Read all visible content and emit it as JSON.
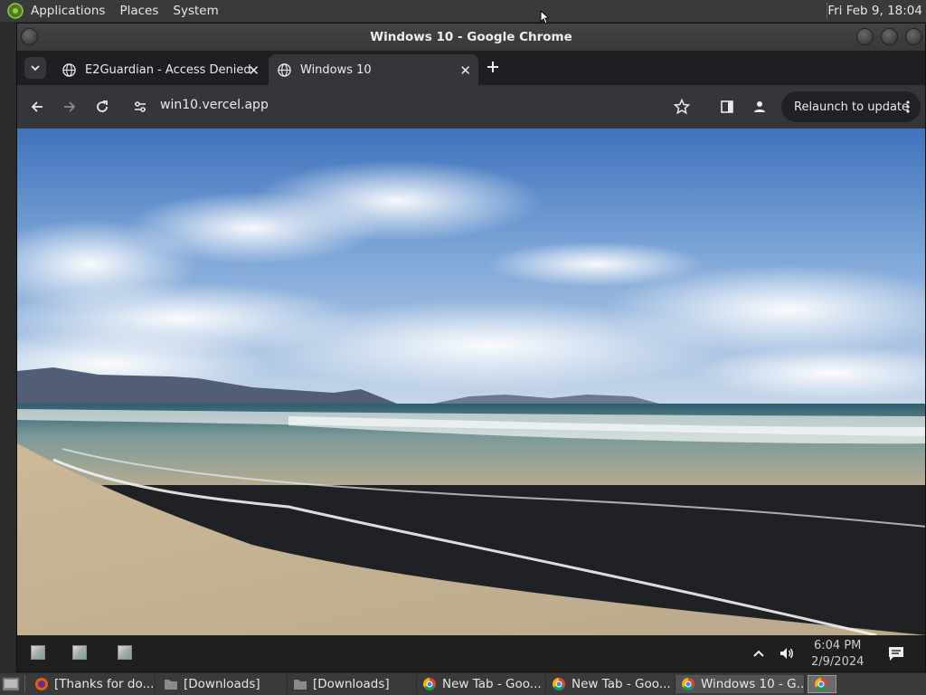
{
  "top_panel": {
    "menus": [
      "Applications",
      "Places",
      "System"
    ],
    "clock": "Fri Feb  9, 18:04"
  },
  "window": {
    "title": "Windows 10 - Google Chrome"
  },
  "tabs": [
    {
      "label": "E2Guardian - Access Denied",
      "active": false
    },
    {
      "label": "Windows 10",
      "active": true
    }
  ],
  "toolbar": {
    "url": "win10.vercel.app",
    "relaunch_label": "Relaunch to update"
  },
  "win_taskbar": {
    "time": "6:04 PM",
    "date": "2/9/2024"
  },
  "bottom_panel": {
    "tasks": [
      {
        "label": "[Thanks for do...",
        "icon": "firefox-icon",
        "active": false
      },
      {
        "label": "[Downloads]",
        "icon": "folder-icon",
        "active": false
      },
      {
        "label": "[Downloads]",
        "icon": "folder-icon",
        "active": false
      },
      {
        "label": "New Tab - Goo...",
        "icon": "chrome-icon",
        "active": false
      },
      {
        "label": "New Tab - Goo...",
        "icon": "chrome-icon",
        "active": false
      },
      {
        "label": "Windows 10 - G...",
        "icon": "chrome-icon",
        "active": true
      }
    ]
  },
  "colors": {
    "chrome_dark": "#202124",
    "toolbar": "#35363a",
    "sky": "#4a7cc4",
    "sand": "#c4b79a"
  }
}
